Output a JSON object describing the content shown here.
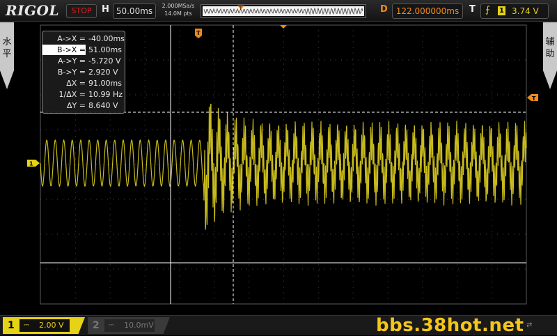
{
  "header": {
    "logo": "RIGOL",
    "run_state": "STOP",
    "horizontal_label": "H",
    "timebase": "50.00ms",
    "sample_rate": "2.000MSa/s",
    "mem_depth": "14.0M pts",
    "delay_label": "D",
    "delay": "122.000000ms",
    "trigger_label": "T",
    "trigger_source": "1",
    "trigger_level": "3.74 V"
  },
  "side_tabs": {
    "left": [
      "水",
      "平"
    ],
    "right": [
      "辅",
      "助"
    ]
  },
  "markers": {
    "channel1": "1",
    "trigger_pos": "T",
    "trigger_level": "T"
  },
  "cursor_readout": {
    "rows": [
      {
        "label": "A->X =",
        "value": "-40.00ms"
      },
      {
        "label": "B->X =",
        "value": "51.00ms"
      },
      {
        "label": "A->Y =",
        "value": "-5.720 V"
      },
      {
        "label": "B->Y =",
        "value": "2.920 V"
      },
      {
        "label": "ΔX =",
        "value": "91.00ms"
      },
      {
        "label": "1/ΔX =",
        "value": "10.99 Hz"
      },
      {
        "label": "ΔY =",
        "value": "8.640 V"
      }
    ]
  },
  "bottom": {
    "ch1_number": "1",
    "ch1_coupling": "⎓",
    "ch1_scale": "2.00 V",
    "ch2_number": "2",
    "ch2_coupling": "⎓",
    "ch2_scale": "10.0mV",
    "watermark": "bbs.38hot.net"
  },
  "colors": {
    "ch1": "#e6d318",
    "trigger": "#f08a1c",
    "stop": "#e02020"
  }
}
